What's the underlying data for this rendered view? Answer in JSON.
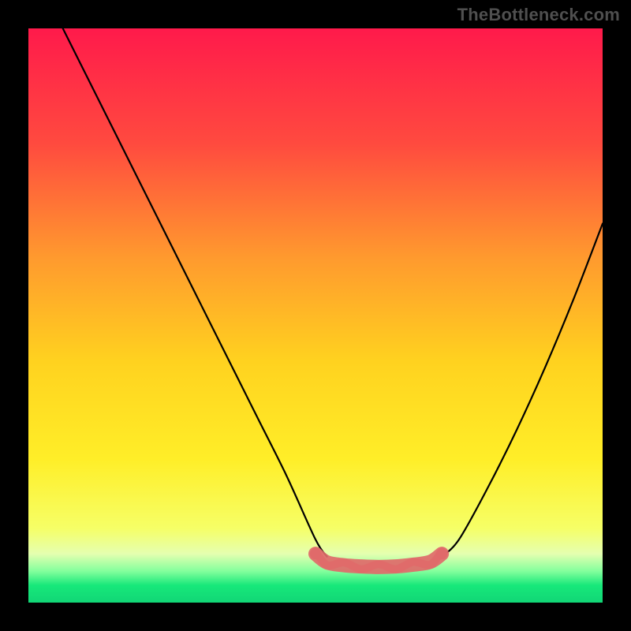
{
  "watermark": "TheBottleneck.com",
  "chart_data": {
    "type": "line",
    "title": "",
    "xlabel": "",
    "ylabel": "",
    "xlim": [
      0,
      100
    ],
    "ylim": [
      0,
      100
    ],
    "grid": false,
    "legend": false,
    "background_gradient": {
      "stops": [
        {
          "offset": 0.0,
          "color": "#ff1a4b"
        },
        {
          "offset": 0.2,
          "color": "#ff4a3f"
        },
        {
          "offset": 0.4,
          "color": "#ff9a2e"
        },
        {
          "offset": 0.58,
          "color": "#ffd21f"
        },
        {
          "offset": 0.75,
          "color": "#ffee28"
        },
        {
          "offset": 0.87,
          "color": "#f6ff66"
        },
        {
          "offset": 0.915,
          "color": "#e5ffb0"
        },
        {
          "offset": 0.945,
          "color": "#84ff9d"
        },
        {
          "offset": 0.97,
          "color": "#17e87a"
        },
        {
          "offset": 1.0,
          "color": "#11d676"
        }
      ]
    },
    "series": [
      {
        "name": "left-branch",
        "style": "curve",
        "color": "#000000",
        "x": [
          6,
          10,
          15,
          20,
          25,
          30,
          35,
          40,
          45,
          50,
          52
        ],
        "y": [
          100,
          92,
          82,
          72,
          62,
          52,
          42,
          32,
          22,
          11,
          8
        ]
      },
      {
        "name": "right-branch",
        "style": "curve",
        "color": "#000000",
        "x": [
          72,
          75,
          80,
          85,
          90,
          95,
          100
        ],
        "y": [
          8,
          11,
          20,
          30,
          41,
          53,
          66
        ]
      },
      {
        "name": "bottom-band",
        "style": "band",
        "color": "#e06a6a",
        "x": [
          50,
          52,
          55,
          58,
          61,
          64,
          67,
          70,
          72
        ],
        "y": [
          8.5,
          7.0,
          6.5,
          6.3,
          6.2,
          6.3,
          6.6,
          7.1,
          8.5
        ]
      }
    ],
    "markers": [
      {
        "x": 50.0,
        "y": 8.5,
        "color": "#e06a6a"
      },
      {
        "x": 72.0,
        "y": 8.5,
        "color": "#e06a6a"
      }
    ]
  }
}
